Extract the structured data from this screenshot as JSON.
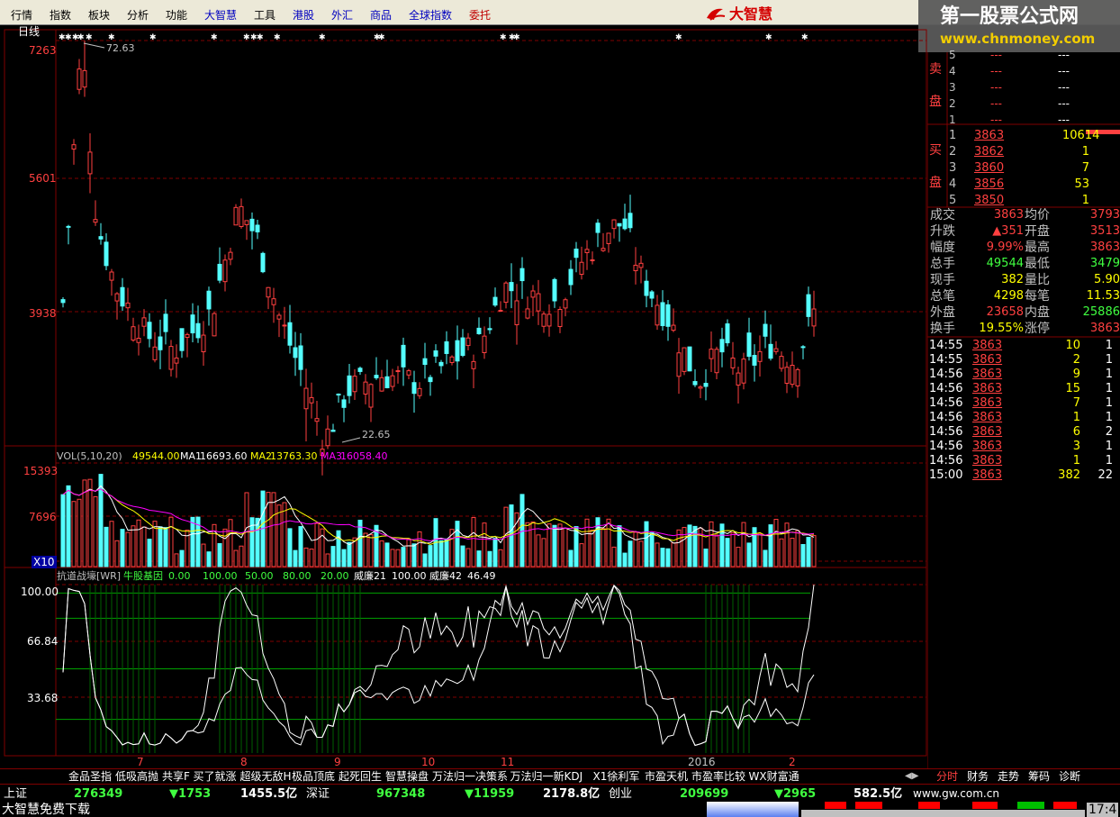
{
  "menu": [
    "行情",
    "指数",
    "板块",
    "分析",
    "功能",
    "大智慧",
    "工具",
    "港股",
    "外汇",
    "商品",
    "全球指数",
    "委托"
  ],
  "logo": "大智慧",
  "watermark": {
    "line1": "第一股票公式网",
    "line2": "www.chnmoney.com"
  },
  "period": "日线",
  "price_axis": {
    "labels": [
      "7263",
      "5601",
      "3938"
    ]
  },
  "price_annot": {
    "high": "72.63",
    "low": "22.65"
  },
  "vol_header": {
    "name": "VOL(5,10,20)",
    "vol": "49544.00",
    "ma1_label": "MA1",
    "ma1": "16693.60",
    "ma2_label": "MA2",
    "ma2": "13763.30",
    "ma3_label": "MA3",
    "ma3": "16058.40"
  },
  "vol_axis": {
    "labels": [
      "15393",
      "7696"
    ],
    "unit": "X10"
  },
  "ind_header": {
    "name": "抗道战壕[WR]",
    "t1": "牛股基因",
    "v1": "0.00",
    "v2": "100.00",
    "v3": "50.00",
    "v4": "80.00",
    "v5": "20.00",
    "w1": "威廉21",
    "w1v": "100.00",
    "w2": "威廉42",
    "w2v": "46.49"
  },
  "ind_axis": {
    "labels": [
      "100.00",
      "66.84",
      "33.68"
    ]
  },
  "x_axis": [
    "7",
    "8",
    "9",
    "10",
    "11",
    "2016",
    "2"
  ],
  "sell": {
    "label1": "卖",
    "label2": "盘",
    "rows": [
      {
        "n": "5",
        "p": "---",
        "v": "---"
      },
      {
        "n": "4",
        "p": "---",
        "v": "---"
      },
      {
        "n": "3",
        "p": "---",
        "v": "---"
      },
      {
        "n": "2",
        "p": "---",
        "v": "---"
      },
      {
        "n": "1",
        "p": "---",
        "v": "---"
      }
    ]
  },
  "buy": {
    "label1": "买",
    "label2": "盘",
    "rows": [
      {
        "n": "1",
        "p": "3863",
        "v": "10614"
      },
      {
        "n": "2",
        "p": "3862",
        "v": "1"
      },
      {
        "n": "3",
        "p": "3860",
        "v": "7"
      },
      {
        "n": "4",
        "p": "3856",
        "v": "53"
      },
      {
        "n": "5",
        "p": "3850",
        "v": "1"
      }
    ]
  },
  "quote": [
    {
      "k1": "成交",
      "v1": "3863",
      "k2": "均价",
      "v2": "3793"
    },
    {
      "k1": "升跌",
      "v1": "▲351",
      "k2": "开盘",
      "v2": "3513"
    },
    {
      "k1": "幅度",
      "v1": "9.99%",
      "k2": "最高",
      "v2": "3863"
    },
    {
      "k1": "总手",
      "v1": "49544",
      "k2": "最低",
      "v2": "3479"
    },
    {
      "k1": "现手",
      "v1": "382",
      "k2": "量比",
      "v2": "5.90"
    },
    {
      "k1": "总笔",
      "v1": "4298",
      "k2": "每笔",
      "v2": "11.53"
    },
    {
      "k1": "外盘",
      "v1": "23658",
      "k2": "内盘",
      "v2": "25886"
    },
    {
      "k1": "换手",
      "v1": "19.55%",
      "k2": "涨停",
      "v2": "3863"
    }
  ],
  "ticks": [
    {
      "t": "14:55",
      "p": "3863",
      "v": "10",
      "c": "1"
    },
    {
      "t": "14:55",
      "p": "3863",
      "v": "2",
      "c": "1"
    },
    {
      "t": "14:56",
      "p": "3863",
      "v": "9",
      "c": "1"
    },
    {
      "t": "14:56",
      "p": "3863",
      "v": "15",
      "c": "1"
    },
    {
      "t": "14:56",
      "p": "3863",
      "v": "7",
      "c": "1"
    },
    {
      "t": "14:56",
      "p": "3863",
      "v": "1",
      "c": "1"
    },
    {
      "t": "14:56",
      "p": "3863",
      "v": "6",
      "c": "2"
    },
    {
      "t": "14:56",
      "p": "3863",
      "v": "3",
      "c": "1"
    },
    {
      "t": "14:56",
      "p": "3863",
      "v": "1",
      "c": "1"
    },
    {
      "t": "15:00",
      "p": "3863",
      "v": "382",
      "c": "22"
    }
  ],
  "tabs": [
    "金品圣指",
    "低吸高抛",
    "共享F",
    "买了就涨",
    "超级无敌H",
    "极品顶底",
    "起死回生",
    "智慧操盘",
    "万法归一决策系",
    "万法归一新KDJ",
    "X1徐利军",
    "市盈天机",
    "市盈率比较",
    "WX财富通"
  ],
  "right_tabs": [
    "分时",
    "财务",
    "走势",
    "筹码",
    "诊断"
  ],
  "status": {
    "sh_name": "上证",
    "sh_val": "276349",
    "sh_chg": "▼1753",
    "sh_amt": "1455.5亿",
    "sz_name": "深证",
    "sz_val": "967348",
    "sz_chg": "▼11959",
    "sz_amt": "2178.8亿",
    "cy_name": "创业",
    "cy_val": "209699",
    "cy_chg": "▼2965",
    "cy_amt": "582.5亿",
    "site": "www.gw.com.cn"
  },
  "bottom": {
    "left": "大智慧免费下载",
    "clock": "17:4"
  },
  "colors": {
    "up": "#ff4040",
    "down": "#54ffff",
    "grid": "#800000",
    "ma1": "#ffffff",
    "ma2": "#ffff00",
    "ma3": "#ff00ff"
  }
}
